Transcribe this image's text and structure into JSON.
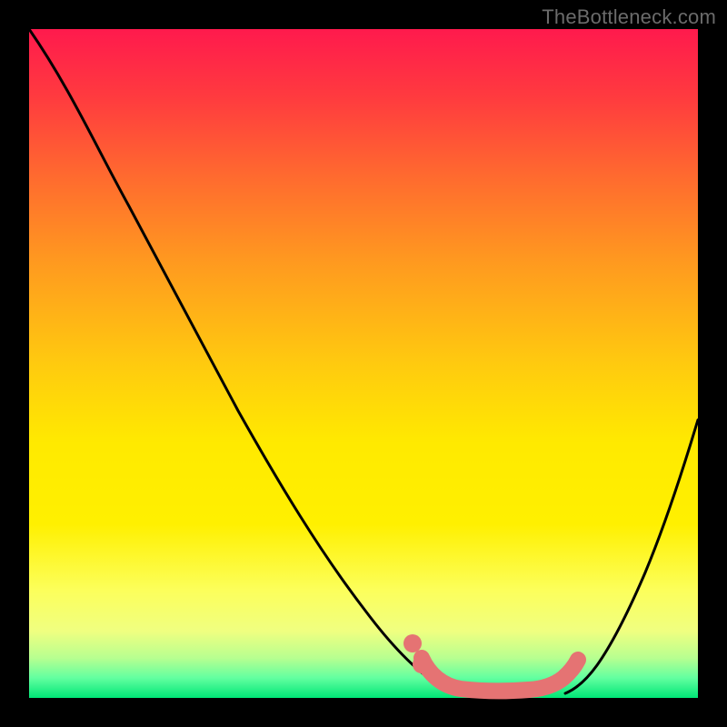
{
  "watermark": "TheBottleneck.com",
  "colors": {
    "frame": "#000000",
    "gradient_top": "#ff1a4d",
    "gradient_bottom": "#00e676",
    "curve": "#000000",
    "overlay": "#e57373"
  },
  "chart_data": {
    "type": "line",
    "title": "",
    "xlabel": "",
    "ylabel": "",
    "xlim": [
      0,
      100
    ],
    "ylim": [
      0,
      100
    ],
    "series": [
      {
        "name": "bottleneck-curve-left",
        "x": [
          0,
          5,
          10,
          15,
          20,
          25,
          30,
          35,
          40,
          45,
          50,
          55,
          58,
          61,
          64
        ],
        "values": [
          100,
          91,
          82,
          73,
          64,
          55,
          46,
          37,
          29,
          21,
          14,
          8,
          5,
          3,
          1.5
        ]
      },
      {
        "name": "bottleneck-curve-right",
        "x": [
          80,
          82,
          85,
          88,
          91,
          94,
          97,
          100
        ],
        "values": [
          1.5,
          3,
          6,
          12,
          20,
          30,
          41,
          53
        ]
      },
      {
        "name": "optimal-zone",
        "x": [
          59,
          61,
          64,
          68,
          72,
          76,
          79,
          80
        ],
        "values": [
          6,
          3,
          1.5,
          1.2,
          1.2,
          1.5,
          2.5,
          4
        ]
      }
    ],
    "markers": [
      {
        "name": "pink-dot-upper",
        "x": 58,
        "y": 7
      },
      {
        "name": "pink-dot-lower",
        "x": 60,
        "y": 4
      }
    ]
  }
}
